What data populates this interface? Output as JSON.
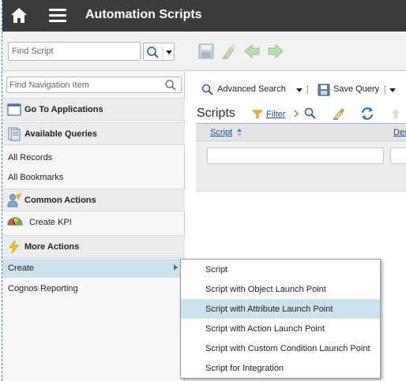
{
  "header": {
    "title": "Automation Scripts",
    "home_icon": "home-icon",
    "menu_icon": "hamburger-menu-icon",
    "background": "#3c3c3c"
  },
  "toolbar": {
    "find_placeholder": "Find Script",
    "icons": [
      "search-icon",
      "save-icon",
      "clear-changes-icon",
      "previous-record-icon",
      "next-record-icon"
    ]
  },
  "sidebar": {
    "search_placeholder": "Find Navigation Item",
    "sections": {
      "go_to_applications": "Go To Applications",
      "available_queries": "Available Queries",
      "common_actions": "Common Actions",
      "more_actions": "More Actions"
    },
    "queries": [
      "All Records",
      "All Bookmarks"
    ],
    "common": [
      "Create KPI"
    ],
    "more": [
      "Create",
      "Cognos Reporting"
    ],
    "highlight_color": "#cce3ee"
  },
  "main": {
    "advanced_search": "Advanced Search",
    "save_query": "Save Query",
    "scripts_title": "Scripts",
    "filter_label": "Filter",
    "columns": [
      "Script",
      "Des"
    ]
  },
  "popup": {
    "items": [
      "Script",
      "Script with Object Launch Point",
      "Script with Attribute Launch Point",
      "Script with Action Launch Point",
      "Script with Custom Condition Launch Point",
      "Script for Integration"
    ],
    "highlighted_index": 2
  }
}
